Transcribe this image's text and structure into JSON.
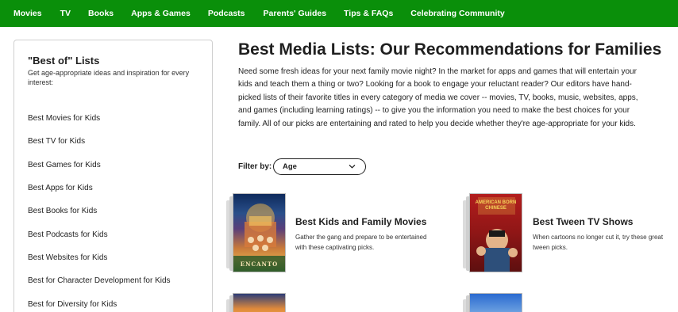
{
  "nav": {
    "items": [
      "Movies",
      "TV",
      "Books",
      "Apps & Games",
      "Podcasts",
      "Parents' Guides",
      "Tips & FAQs",
      "Celebrating Community"
    ]
  },
  "sidebar": {
    "title": "\"Best of\" Lists",
    "description": "Get age-appropriate ideas and inspiration for every interest:",
    "items": [
      {
        "label": "Best Movies for Kids"
      },
      {
        "label": "Best TV for Kids"
      },
      {
        "label": "Best Games for Kids"
      },
      {
        "label": "Best Apps for Kids"
      },
      {
        "label": "Best Books for Kids"
      },
      {
        "label": "Best Podcasts for Kids"
      },
      {
        "label": "Best Websites for Kids"
      },
      {
        "label": "Best for Character Development for Kids"
      },
      {
        "label": "Best for Diversity for Kids"
      }
    ]
  },
  "main": {
    "title": "Best Media Lists: Our Recommendations for Families",
    "intro": "Need some fresh ideas for your next family movie night? In the market for apps and games that will entertain your kids and teach them a thing or two? Looking for a book to engage your reluctant reader? Our editors have hand-picked lists of their favorite titles in every category of media we cover -- movies, TV, books, music, websites, apps, and games (including learning ratings) -- to give you the information you need to make the best choices for your family. All of our picks are entertaining and rated to help you decide whether they're age-appropriate for your kids.",
    "filter": {
      "label": "Filter by:",
      "value": "Age"
    },
    "cards": [
      {
        "title": "Best Kids and Family Movies",
        "desc": "Gather the gang and prepare to be entertained with these captivating picks.",
        "poster_text": "ENCANTO"
      },
      {
        "title": "Best Tween TV Shows",
        "desc": "When cartoons no longer cut it, try these great tween picks.",
        "poster_text": "AMERICAN BORN CHINESE"
      }
    ]
  },
  "colors": {
    "nav_bg": "#0a8f0a",
    "nav_text": "#ffffff",
    "text": "#1f1f1f",
    "border": "#cfcfcf"
  }
}
